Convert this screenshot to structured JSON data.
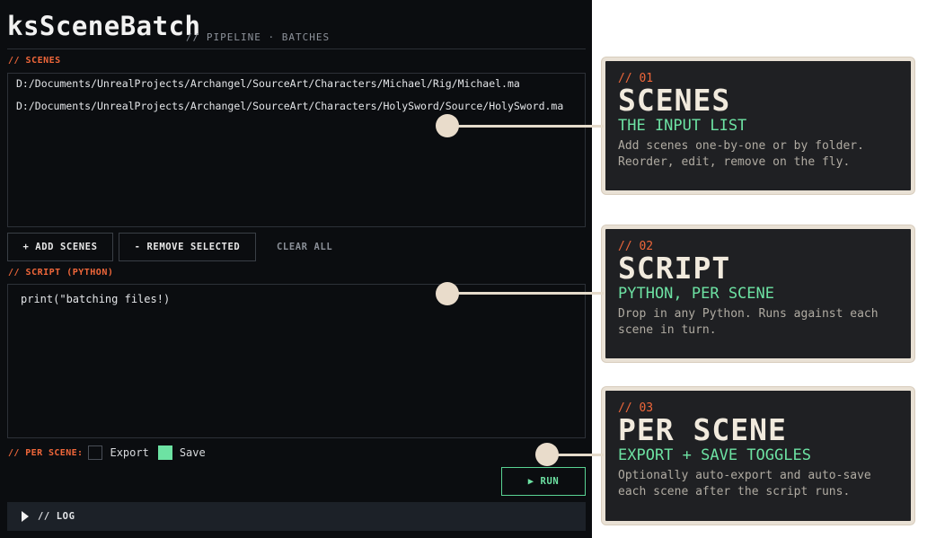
{
  "app": {
    "title": "ksSceneBatch",
    "subtitle": "// PIPELINE · BATCHES",
    "scenes_label": "// SCENES",
    "scenes": [
      "D:/Documents/UnrealProjects/Archangel/SourceArt/Characters/Michael/Rig/Michael.ma",
      "D:/Documents/UnrealProjects/Archangel/SourceArt/Characters/HolySword/Source/HolySword.ma"
    ],
    "buttons": {
      "add_scenes": "+ ADD SCENES",
      "remove_selected": "- REMOVE SELECTED",
      "clear_all": "CLEAR ALL",
      "run": "▶ RUN"
    },
    "script_label": "// SCRIPT (PYTHON)",
    "script_code": "print(\"batching files!)",
    "per_scene_label": "// PER SCENE:",
    "options": [
      {
        "label": "Export",
        "checked": false
      },
      {
        "label": "Save",
        "checked": true
      }
    ],
    "log_label": "// LOG"
  },
  "cards": [
    {
      "number": "// 01",
      "title": "SCENES",
      "subtitle": "THE INPUT LIST",
      "description": "Add scenes one-by-one or by folder. Reorder, edit, remove on the fly."
    },
    {
      "number": "// 02",
      "title": "SCRIPT",
      "subtitle": "PYTHON, PER SCENE",
      "description": "Drop in any Python. Runs against each scene in turn."
    },
    {
      "number": "// 03",
      "title": "PER SCENE",
      "subtitle": "EXPORT + SAVE TOGGLES",
      "description": "Optionally auto-export and auto-save each scene after the script runs."
    }
  ],
  "colors": {
    "accent_orange": "#f0673a",
    "accent_green": "#6de2a3",
    "panel_bg": "#0b0d10",
    "card_bg": "#1f2023",
    "card_border": "#e9e1d5"
  }
}
